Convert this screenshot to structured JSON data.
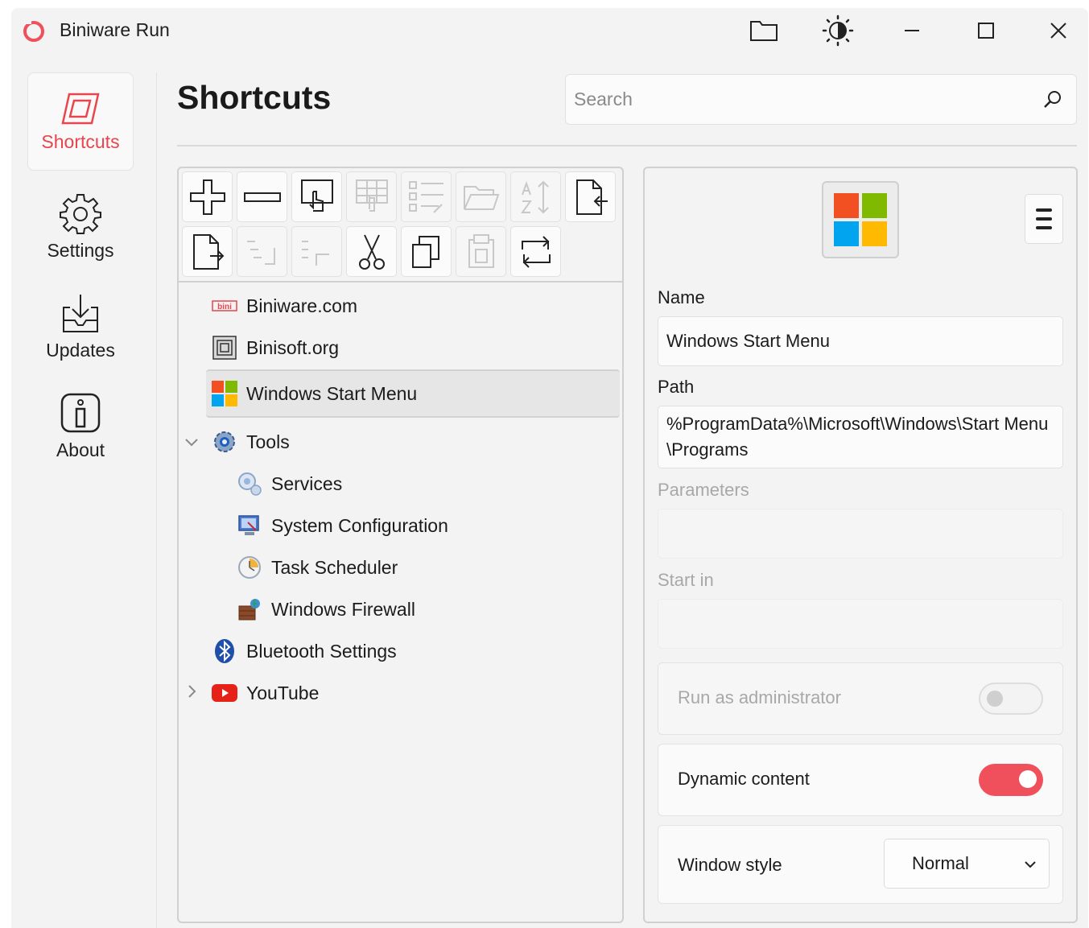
{
  "app": {
    "title": "Biniware Run"
  },
  "titlebar": {
    "buttons": [
      {
        "name": "open-folder",
        "icon": "folder-icon"
      },
      {
        "name": "theme",
        "icon": "brightness-icon"
      },
      {
        "name": "minimize",
        "icon": "minimize-icon"
      },
      {
        "name": "maximize",
        "icon": "maximize-icon"
      },
      {
        "name": "close",
        "icon": "close-icon"
      }
    ]
  },
  "nav": {
    "items": [
      {
        "label": "Shortcuts",
        "icon": "shortcuts-icon",
        "active": true
      },
      {
        "label": "Settings",
        "icon": "gear-icon",
        "active": false
      },
      {
        "label": "Updates",
        "icon": "download-icon",
        "active": false
      },
      {
        "label": "About",
        "icon": "info-icon",
        "active": false
      }
    ]
  },
  "header": {
    "title": "Shortcuts"
  },
  "search": {
    "placeholder": "Search",
    "value": ""
  },
  "toolbar": {
    "tools": [
      {
        "name": "add",
        "enabled": true
      },
      {
        "name": "remove",
        "enabled": true
      },
      {
        "name": "run",
        "enabled": true
      },
      {
        "name": "run-grid",
        "enabled": false
      },
      {
        "name": "list-details",
        "enabled": false
      },
      {
        "name": "open-location",
        "enabled": false
      },
      {
        "name": "sort",
        "enabled": false
      },
      {
        "name": "import",
        "enabled": true
      },
      {
        "name": "export",
        "enabled": true
      },
      {
        "name": "indent",
        "enabled": false
      },
      {
        "name": "outdent",
        "enabled": false
      },
      {
        "name": "cut",
        "enabled": true
      },
      {
        "name": "copy",
        "enabled": true
      },
      {
        "name": "paste",
        "enabled": false
      },
      {
        "name": "refresh",
        "enabled": true
      }
    ]
  },
  "tree": {
    "items": [
      {
        "label": "Biniware.com",
        "icon": "biniware-icon",
        "level": 0
      },
      {
        "label": "Binisoft.org",
        "icon": "binisoft-icon",
        "level": 0
      },
      {
        "label": "Windows Start Menu",
        "icon": "windows-icon",
        "level": 0,
        "selected": true
      },
      {
        "label": "Tools",
        "icon": "tools-gear-icon",
        "level": 0,
        "expanded": true
      },
      {
        "label": "Services",
        "icon": "services-icon",
        "level": 1
      },
      {
        "label": "System Configuration",
        "icon": "system-config-icon",
        "level": 1
      },
      {
        "label": "Task Scheduler",
        "icon": "task-scheduler-icon",
        "level": 1
      },
      {
        "label": "Windows Firewall",
        "icon": "firewall-icon",
        "level": 1
      },
      {
        "label": "Bluetooth Settings",
        "icon": "bluetooth-icon",
        "level": 0
      },
      {
        "label": "YouTube",
        "icon": "youtube-icon",
        "level": 0,
        "expanded": false
      }
    ]
  },
  "details": {
    "name_label": "Name",
    "name_value": "Windows Start Menu",
    "path_label": "Path",
    "path_value": "%ProgramData%\\Microsoft\\Windows\\Start Menu\\Programs",
    "parameters_label": "Parameters",
    "parameters_value": "",
    "startin_label": "Start in",
    "startin_value": "",
    "run_admin_label": "Run as administrator",
    "run_admin_on": false,
    "dynamic_label": "Dynamic content",
    "dynamic_on": true,
    "window_style_label": "Window style",
    "window_style_value": "Normal"
  },
  "colors": {
    "accent": "#f0505b",
    "accent_text": "#e8454d",
    "win_red": "#f25022",
    "win_green": "#7fba00",
    "win_blue": "#00a4ef",
    "win_yellow": "#ffb900"
  }
}
